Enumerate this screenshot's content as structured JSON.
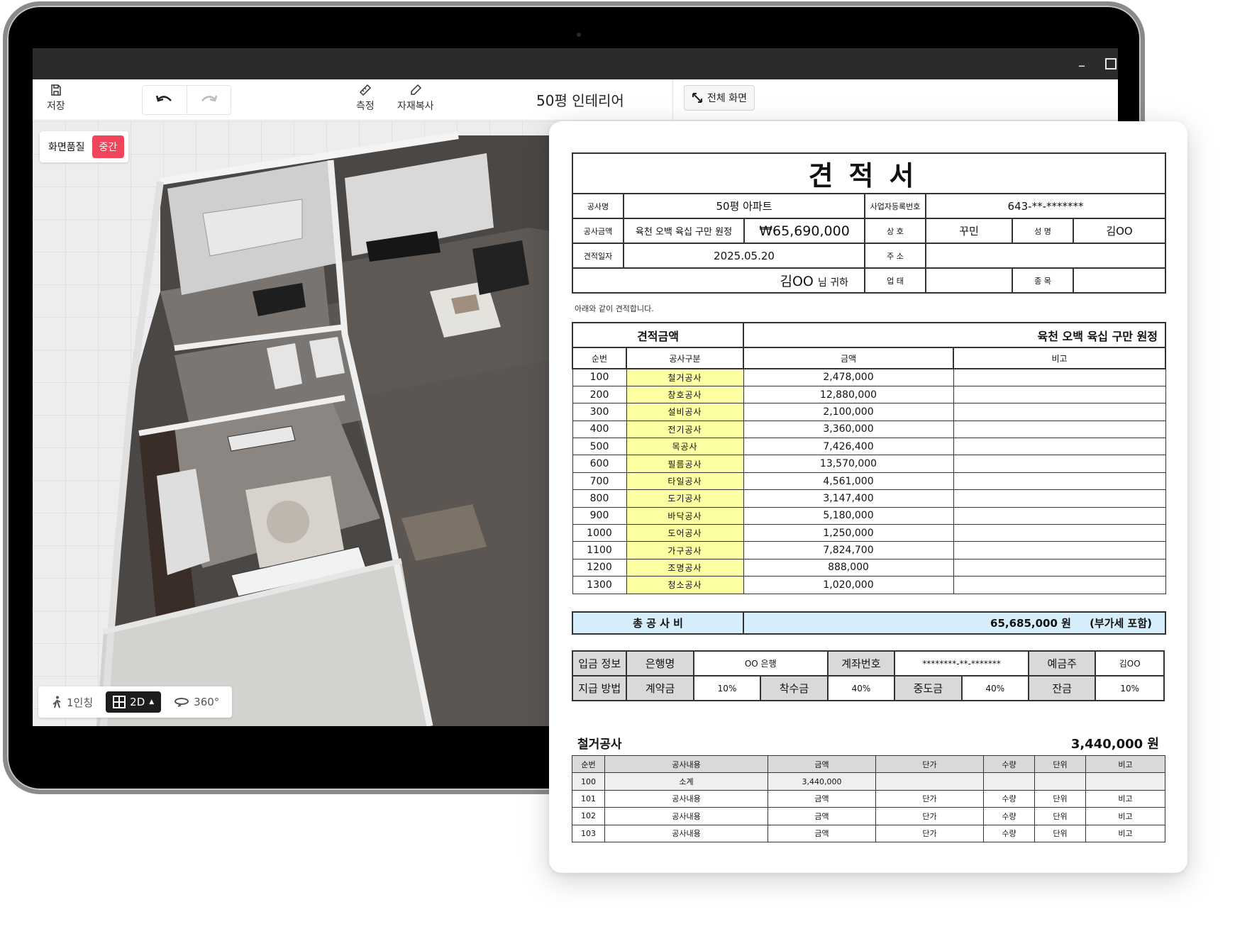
{
  "app": {
    "toolbar": {
      "save_label": "저장",
      "measure_label": "측정",
      "copy_material_label": "자재복사",
      "project_title": "50평 인테리어",
      "fullscreen_label": "전체 화면"
    },
    "viewport": {
      "quality_label": "화면품질",
      "quality_value": "중간",
      "first_person_label": "1인칭",
      "view_2d_label": "2D",
      "view_360_label": "360°"
    }
  },
  "estimate": {
    "title": "견적서",
    "header": {
      "project_name_label": "공사명",
      "project_name": "50평 아파트",
      "biz_no_label": "사업자등록번호",
      "biz_no": "643-**-*******",
      "amount_label": "공사금액",
      "amount_korean": "육천 오백 육십 구만 원정",
      "amount": "₩65,690,000",
      "company_label": "상 호",
      "company": "꾸민",
      "name_label": "성 명",
      "name": "김OO",
      "date_label": "견적일자",
      "date": "2025.05.20",
      "address_label": "주 소",
      "address": "",
      "recipient": "김OO",
      "recipient_suffix": "님 귀하",
      "business_type_label": "업 태",
      "business_type": "",
      "category_label": "종 목",
      "category": ""
    },
    "intro": "아래와 같이 견적합니다.",
    "summary": {
      "amount_label": "견적금액",
      "amount_text": "육천 오백 육십 구만 원정",
      "columns": [
        "순번",
        "공사구분",
        "금액",
        "비고"
      ],
      "rows": [
        {
          "no": "100",
          "cat": "철거공사",
          "amount": "2,478,000",
          "note": ""
        },
        {
          "no": "200",
          "cat": "창호공사",
          "amount": "12,880,000",
          "note": ""
        },
        {
          "no": "300",
          "cat": "설비공사",
          "amount": "2,100,000",
          "note": ""
        },
        {
          "no": "400",
          "cat": "전기공사",
          "amount": "3,360,000",
          "note": ""
        },
        {
          "no": "500",
          "cat": "목공사",
          "amount": "7,426,400",
          "note": ""
        },
        {
          "no": "600",
          "cat": "필름공사",
          "amount": "13,570,000",
          "note": ""
        },
        {
          "no": "700",
          "cat": "타일공사",
          "amount": "4,561,000",
          "note": ""
        },
        {
          "no": "800",
          "cat": "도기공사",
          "amount": "3,147,400",
          "note": ""
        },
        {
          "no": "900",
          "cat": "바닥공사",
          "amount": "5,180,000",
          "note": ""
        },
        {
          "no": "1000",
          "cat": "도어공사",
          "amount": "1,250,000",
          "note": ""
        },
        {
          "no": "1100",
          "cat": "가구공사",
          "amount": "7,824,700",
          "note": ""
        },
        {
          "no": "1200",
          "cat": "조명공사",
          "amount": "888,000",
          "note": ""
        },
        {
          "no": "1300",
          "cat": "청소공사",
          "amount": "1,020,000",
          "note": ""
        }
      ]
    },
    "total": {
      "label": "총 공 사 비",
      "value": "65,685,000 원",
      "vat_note": "(부가세 포함)"
    },
    "payment": {
      "deposit_label": "입금 정보",
      "bank_label": "은행명",
      "bank": "OO 은행",
      "account_label": "계좌번호",
      "account": "********-**-*******",
      "holder_label": "예금주",
      "holder": "김OO",
      "method_label": "지급 방법",
      "contract_label": "계약금",
      "contract": "10%",
      "start_label": "착수금",
      "start": "40%",
      "middle_label": "중도금",
      "middle": "40%",
      "balance_label": "잔금",
      "balance": "10%"
    },
    "detail": {
      "title": "철거공사",
      "total": "3,440,000 원",
      "columns": [
        "순번",
        "공사내용",
        "금액",
        "단가",
        "수량",
        "단위",
        "비고"
      ],
      "rows": [
        [
          "100",
          "소계",
          "3,440,000",
          "",
          "",
          "",
          ""
        ],
        [
          "101",
          "공사내용",
          "금액",
          "단가",
          "수량",
          "단위",
          "비고"
        ],
        [
          "102",
          "공사내용",
          "금액",
          "단가",
          "수량",
          "단위",
          "비고"
        ],
        [
          "103",
          "공사내용",
          "금액",
          "단가",
          "수량",
          "단위",
          "비고"
        ]
      ]
    }
  }
}
